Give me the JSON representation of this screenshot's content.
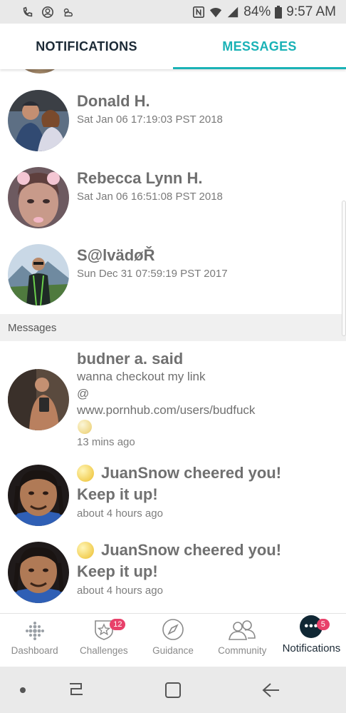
{
  "status_bar": {
    "battery": "84%",
    "time": "9:57 AM"
  },
  "tabs": [
    {
      "label": "NOTIFICATIONS"
    },
    {
      "label": "MESSAGES"
    }
  ],
  "notifications": [
    {
      "name": "Donald H.",
      "date": "Sat Jan 06 17:19:03 PST 2018"
    },
    {
      "name": "Rebecca Lynn H.",
      "date": "Sat Jan 06 16:51:08 PST 2018"
    },
    {
      "name": "S@lvädøŘ",
      "date": "Sun Dec 31 07:59:19 PST 2017"
    }
  ],
  "messages_section": {
    "title": "Messages"
  },
  "messages": [
    {
      "title": "budner a. said",
      "lines": [
        "wanna checkout my link",
        "@",
        "www.pornhub.com/users/budfuck"
      ],
      "time": "13 mins ago"
    },
    {
      "title_line1": "JuanSnow cheered you!",
      "title_line2": "Keep it up!",
      "time": "about 4 hours ago"
    },
    {
      "title_line1": "JuanSnow cheered you!",
      "title_line2": "Keep it up!",
      "time": "about 4 hours ago"
    }
  ],
  "bottom_nav": [
    {
      "label": "Dashboard",
      "icon": "dots-grid-icon"
    },
    {
      "label": "Challenges",
      "icon": "star-shield-icon",
      "badge": "12"
    },
    {
      "label": "Guidance",
      "icon": "compass-icon"
    },
    {
      "label": "Community",
      "icon": "people-icon"
    },
    {
      "label": "Notifications",
      "icon": "chat-dots-icon",
      "badge": "5"
    }
  ],
  "colors": {
    "accent": "#1ab2b6",
    "navy": "#102734",
    "badge": "#e8416a"
  }
}
